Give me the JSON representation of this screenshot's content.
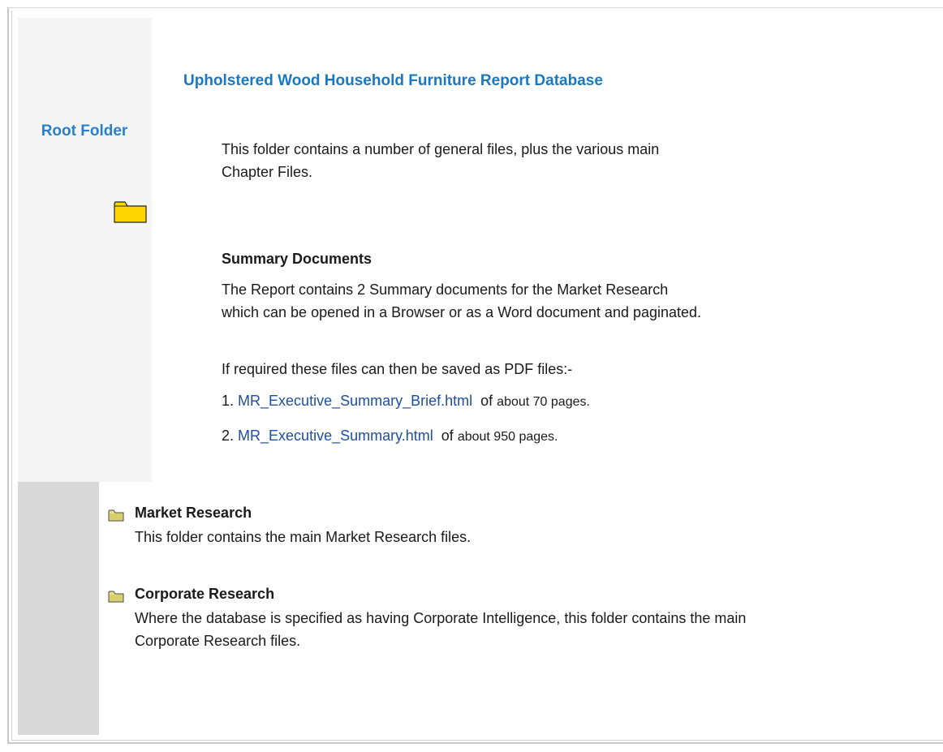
{
  "sidebar": {
    "title": "Root Folder",
    "folder_icon": "folder-icon",
    "folder_color": "#ffd700"
  },
  "main": {
    "title": "Upholstered Wood Household Furniture Report Database",
    "intro": "This folder contains a number of general files, plus the various main Chapter Files.",
    "summary": {
      "heading": "Summary Documents",
      "description": "The Report contains 2 Summary documents for the Market Research which can be opened in a Browser or as a Word document and paginated.",
      "pdf_note": "If required these files can then be saved as PDF files:-",
      "items": [
        {
          "number": "1.",
          "link": "MR_Executive_Summary_Brief.html",
          "of": "of",
          "pages": "about 70 pages."
        },
        {
          "number": "2.",
          "link": "MR_Executive_Summary.html",
          "of": "of",
          "pages": "about 950 pages."
        }
      ]
    }
  },
  "folders": [
    {
      "icon": "folder-icon",
      "title": "Market Research",
      "description": "This folder contains the main Market Research files."
    },
    {
      "icon": "folder-icon",
      "title": "Corporate Research",
      "description": "Where the database is specified as having Corporate Intelligence, this folder contains the main Corporate Research files."
    }
  ],
  "colors": {
    "title_blue": "#1a78c2",
    "link_blue": "#1f4fa0",
    "sidebar_light": "#f5f5f5",
    "sidebar_dark": "#d9d9d9"
  }
}
